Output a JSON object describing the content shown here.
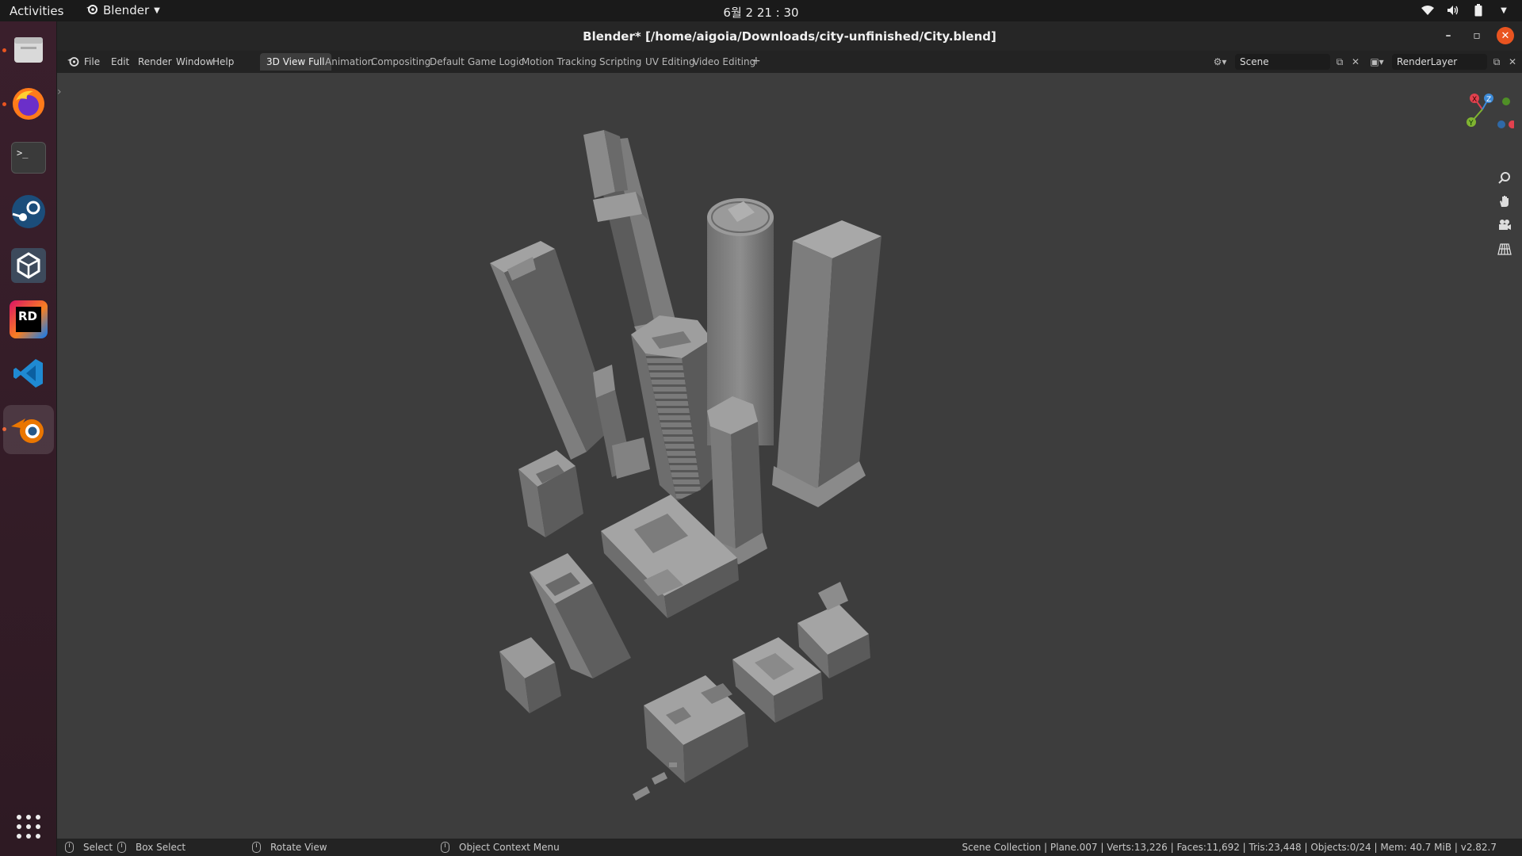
{
  "topbar": {
    "activities": "Activities",
    "app_name": "Blender",
    "clock": "6월 2  21 : 30"
  },
  "dock": {
    "items": [
      {
        "name": "files",
        "icon": "files-icon"
      },
      {
        "name": "firefox",
        "icon": "firefox-icon"
      },
      {
        "name": "terminal",
        "icon": "terminal-icon",
        "text": ">_"
      },
      {
        "name": "steam",
        "icon": "steam-icon"
      },
      {
        "name": "unity",
        "icon": "unity-icon"
      },
      {
        "name": "rider",
        "icon": "rider-icon",
        "text": "RD"
      },
      {
        "name": "vscode",
        "icon": "vscode-icon"
      },
      {
        "name": "blender",
        "icon": "blender-icon"
      }
    ],
    "apps_grid": "show-apps-icon"
  },
  "window": {
    "title": "Blender* [/home/aigoia/Downloads/city-unfinished/City.blend]"
  },
  "menubar": {
    "menus": [
      "File",
      "Edit",
      "Render",
      "Window",
      "Help"
    ],
    "workspaces": [
      "3D View Full",
      "Animation",
      "Compositing",
      "Default",
      "Game Logic",
      "Motion Tracking",
      "Scripting",
      "UV Editing",
      "Video Editing"
    ],
    "active_workspace": "3D View Full",
    "add_tab": "+",
    "scene": "Scene",
    "render_layer": "RenderLayer"
  },
  "statusbar": {
    "select": "Select",
    "box_select": "Box Select",
    "rotate_view": "Rotate View",
    "context_menu": "Object Context Menu",
    "stats": "Scene Collection | Plane.007 | Verts:13,226 | Faces:11,692 | Tris:23,448 | Objects:0/24 | Mem: 40.7 MiB | v2.82.7"
  },
  "gizmo": {
    "x": "X",
    "y": "Y",
    "z": "Z"
  },
  "colors": {
    "accent": "#e95420",
    "axis_x": "#e2414e",
    "axis_y": "#80b431",
    "axis_z": "#3d8bd9",
    "viewport": "#3d3d3d",
    "building": "#8a8a8a"
  }
}
